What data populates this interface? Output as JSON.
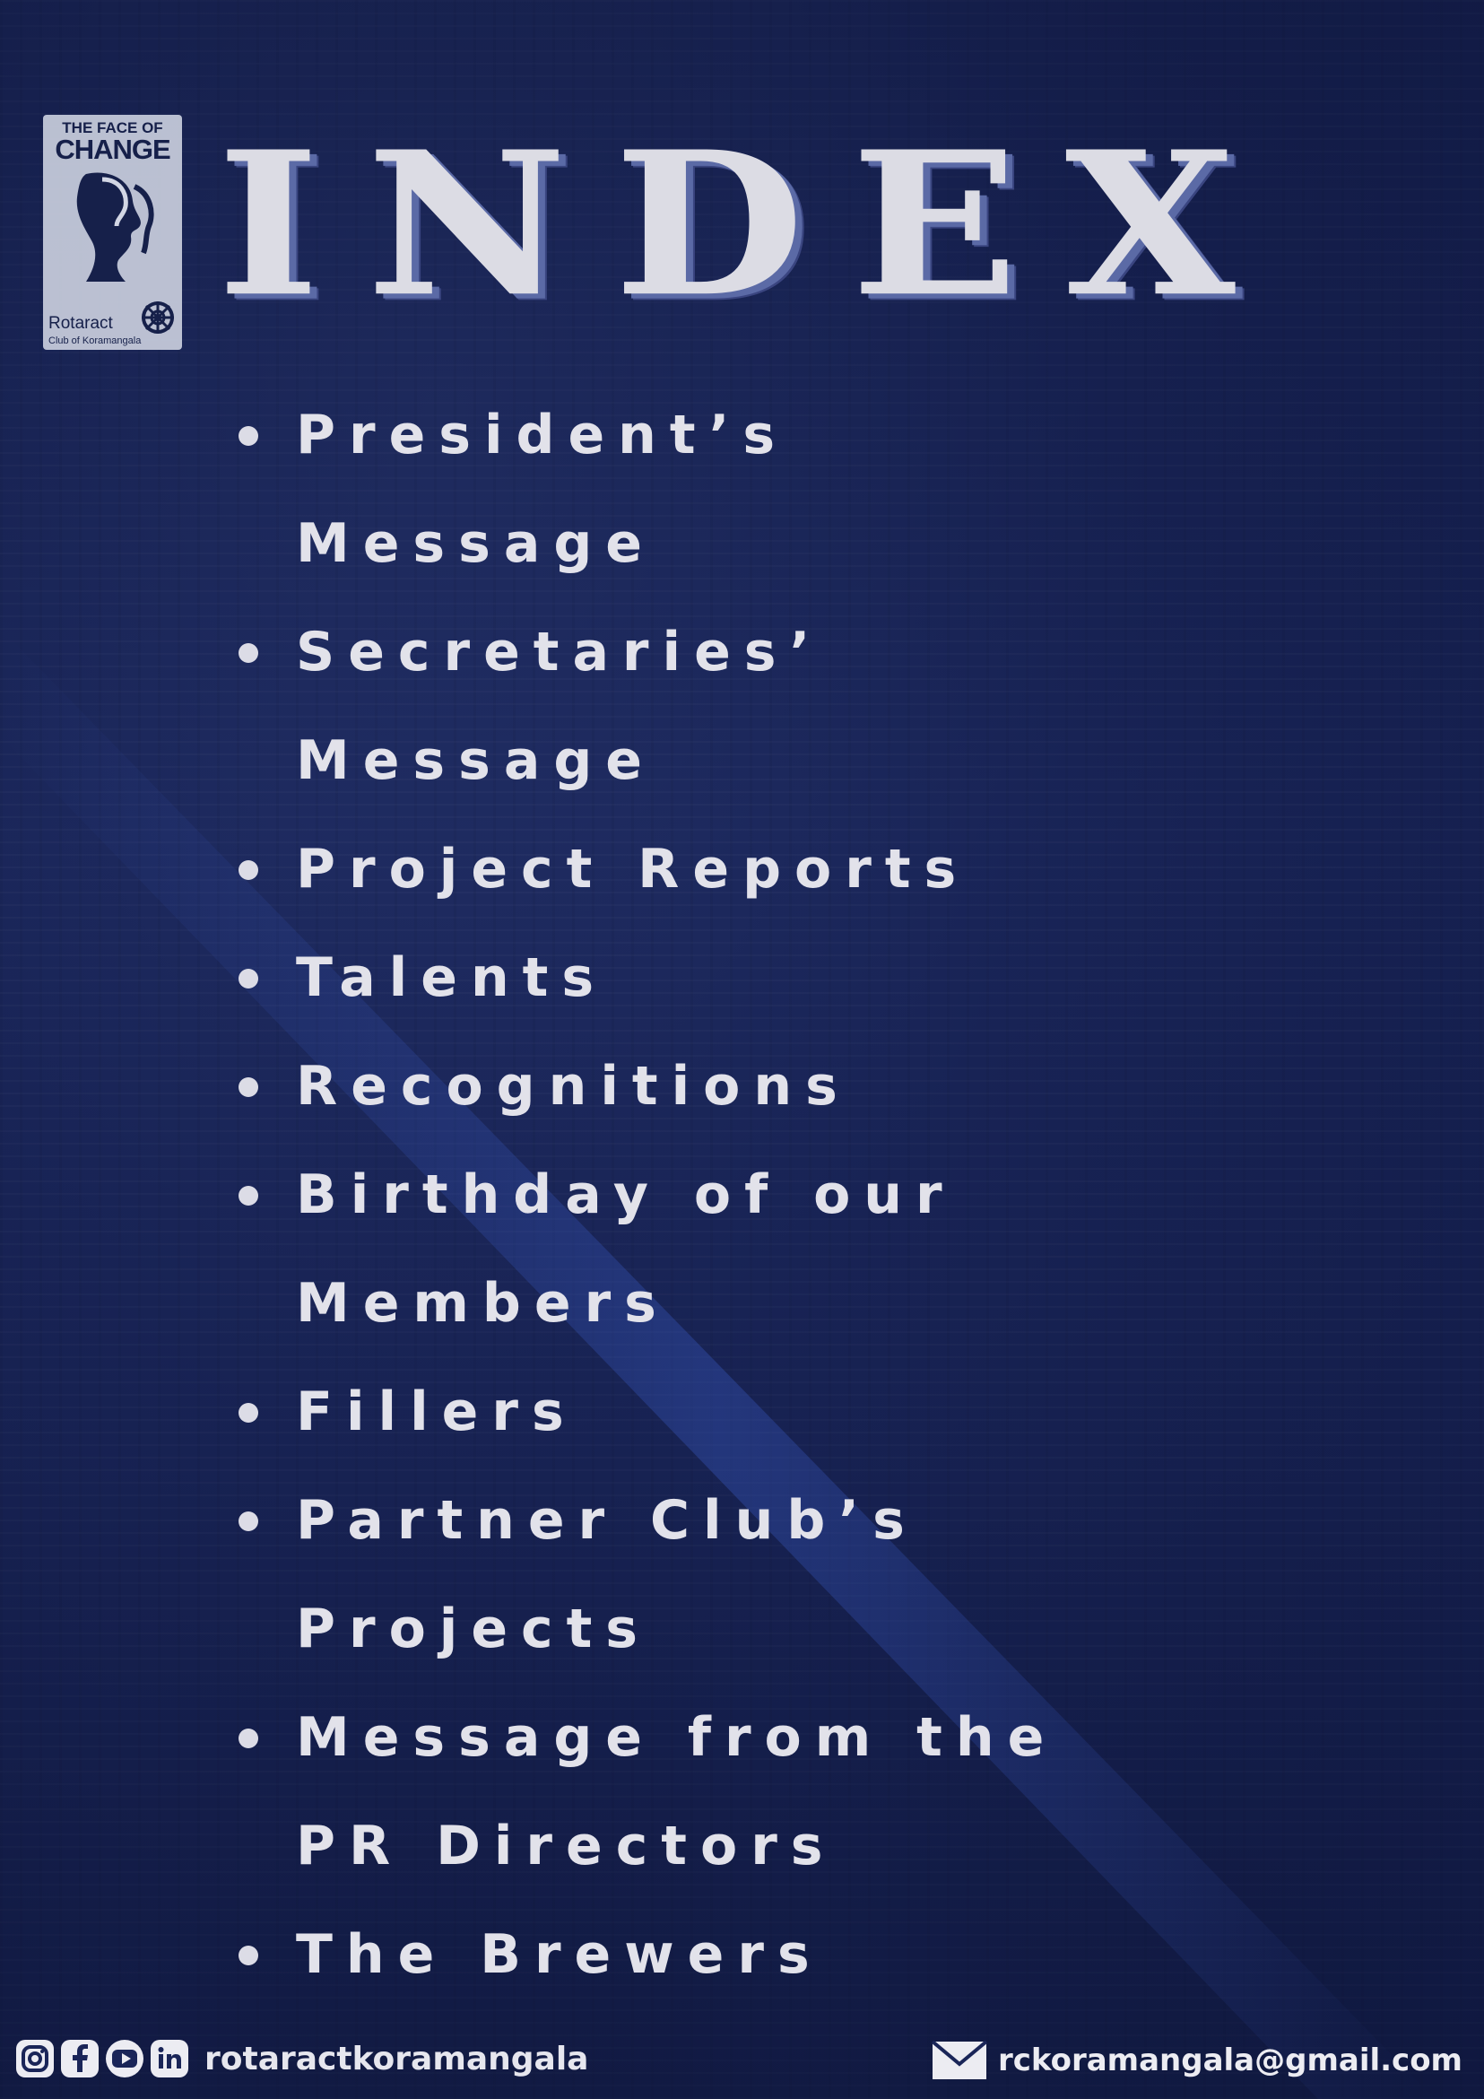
{
  "logo": {
    "tagline_small": "THE FACE OF",
    "tagline_large": "CHANGE",
    "name": "Rotaract",
    "subname": "Club of Koramangala"
  },
  "title": "INDEX",
  "items": [
    {
      "lines": [
        "President’s",
        "Message"
      ]
    },
    {
      "lines": [
        "Secretaries’",
        "Message"
      ]
    },
    {
      "lines": [
        "Project Reports"
      ]
    },
    {
      "lines": [
        "Talents"
      ]
    },
    {
      "lines": [
        "Recognitions"
      ]
    },
    {
      "lines": [
        "Birthday of our",
        "Members"
      ]
    },
    {
      "lines": [
        "Fillers"
      ]
    },
    {
      "lines": [
        "Partner Club’s",
        "Projects"
      ]
    },
    {
      "lines": [
        "Message from the",
        "PR Directors"
      ]
    },
    {
      "lines": [
        "The Brewers"
      ]
    }
  ],
  "footer": {
    "social_icons": [
      "instagram-icon",
      "facebook-icon",
      "youtube-icon",
      "linkedin-icon"
    ],
    "handle": "rotaractkoramangala",
    "email": "rckoramangala@gmail.com"
  },
  "colors": {
    "background": "#1a2558",
    "text": "#e2e2ea",
    "title_shadow": "#5b6aa6"
  }
}
